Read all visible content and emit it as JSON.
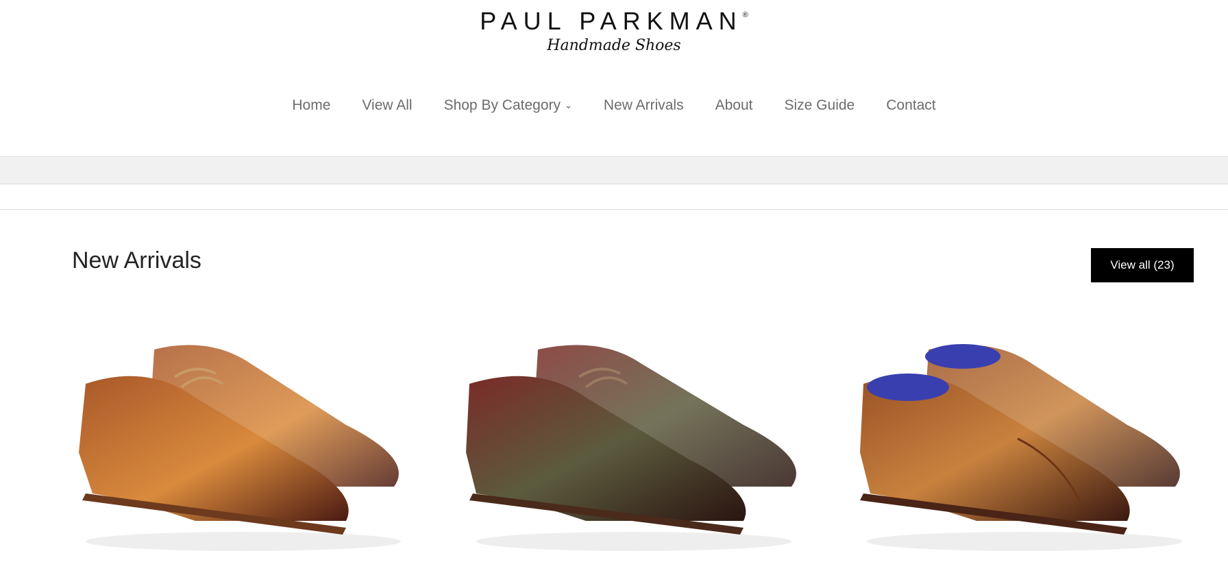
{
  "logo": {
    "brand": "PAUL PARKMAN",
    "registered_mark": "®",
    "tagline": "Handmade Shoes"
  },
  "nav": {
    "items": [
      {
        "label": "Home"
      },
      {
        "label": "View All"
      },
      {
        "label": "Shop By Category",
        "has_dropdown": true
      },
      {
        "label": "New Arrivals"
      },
      {
        "label": "About"
      },
      {
        "label": "Size Guide"
      },
      {
        "label": "Contact"
      }
    ]
  },
  "section": {
    "title": "New Arrivals",
    "view_all_label": "View all (23)"
  },
  "products": [
    {
      "image": "tan-derby-wingtip-shoes",
      "colors": [
        "#c46a23",
        "#8a3f1a",
        "#e0954a"
      ]
    },
    {
      "image": "green-bordeaux-derby-wingtip-shoes",
      "colors": [
        "#8b2e2a",
        "#5c5a3c",
        "#3e1a16"
      ]
    },
    {
      "image": "camel-captoe-oxford-shoes",
      "colors": [
        "#b86a2e",
        "#7a3a18",
        "#3a3fb0"
      ]
    }
  ],
  "colors": {
    "accent_button": "#000000",
    "nav_text": "#6b6b6b",
    "band": "#f1f1f1"
  }
}
